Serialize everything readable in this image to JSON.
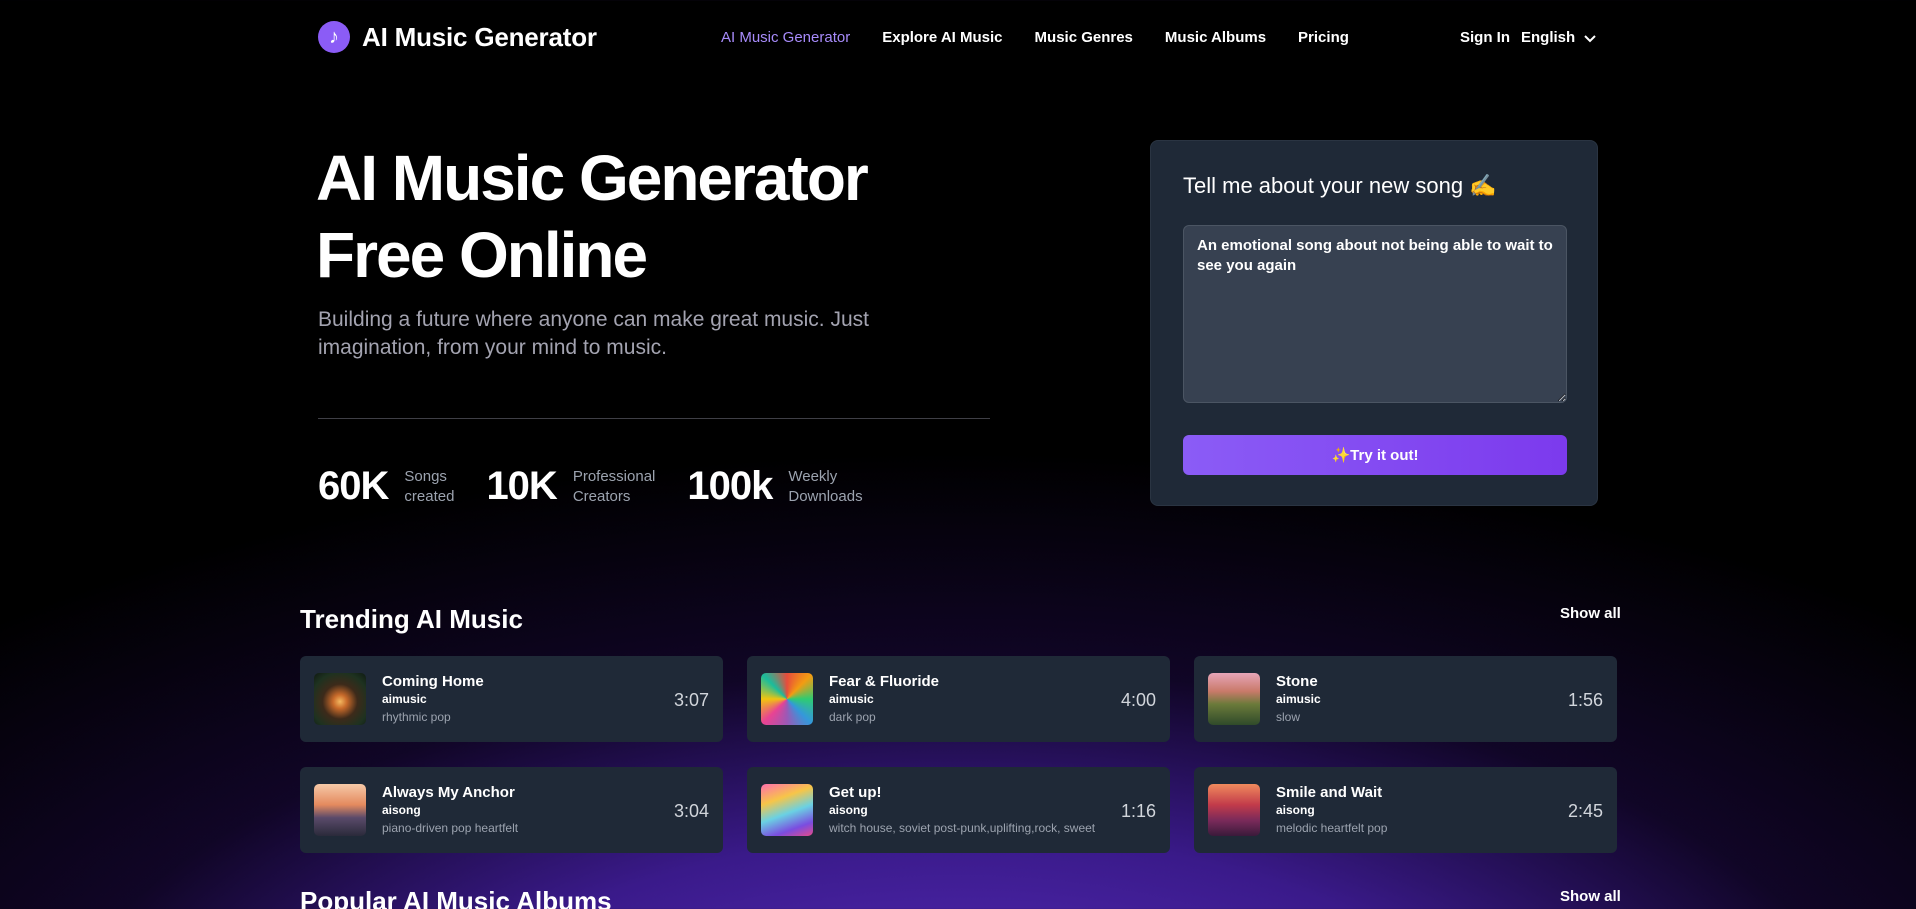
{
  "header": {
    "logo_text": "AI Music Generator",
    "nav": [
      {
        "label": "AI Music Generator",
        "active": true
      },
      {
        "label": "Explore AI Music",
        "active": false
      },
      {
        "label": "Music Genres",
        "active": false
      },
      {
        "label": "Music Albums",
        "active": false
      },
      {
        "label": "Pricing",
        "active": false
      }
    ],
    "sign_in": "Sign In",
    "language": "English"
  },
  "hero": {
    "title_line1": "AI Music Generator",
    "title_line2": "Free Online",
    "subtitle": "Building a future where anyone can make great music. Just imagination, from your mind to music.",
    "stats": [
      {
        "value": "60K",
        "label_line1": "Songs",
        "label_line2": "created"
      },
      {
        "value": "10K",
        "label_line1": "Professional",
        "label_line2": "Creators"
      },
      {
        "value": "100k",
        "label_line1": "Weekly",
        "label_line2": "Downloads"
      }
    ]
  },
  "prompt_card": {
    "title": "Tell me about your new song ✍️",
    "textarea_value": "An emotional song about not being able to wait to see you again",
    "button_label": "✨Try it out!"
  },
  "trending": {
    "title": "Trending AI Music",
    "show_all": "Show all",
    "tracks": [
      {
        "title": "Coming Home",
        "artist": "aimusic",
        "genre": "rhythmic pop",
        "duration": "3:07"
      },
      {
        "title": "Fear & Fluoride",
        "artist": "aimusic",
        "genre": "dark pop",
        "duration": "4:00"
      },
      {
        "title": "Stone",
        "artist": "aimusic",
        "genre": "slow",
        "duration": "1:56"
      },
      {
        "title": "Always My Anchor",
        "artist": "aisong",
        "genre": "piano-driven pop heartfelt",
        "duration": "3:04"
      },
      {
        "title": "Get up!",
        "artist": "aisong",
        "genre": "witch house, soviet post-punk,uplifting,rock, sweet",
        "duration": "1:16"
      },
      {
        "title": "Smile and Wait",
        "artist": "aisong",
        "genre": "melodic heartfelt pop",
        "duration": "2:45"
      }
    ]
  },
  "albums": {
    "title": "Popular AI Music Albums",
    "show_all": "Show all"
  },
  "colors": {
    "accent": "#8b5cf6",
    "active_nav": "#a78bfa",
    "card_bg": "#1f2937"
  }
}
